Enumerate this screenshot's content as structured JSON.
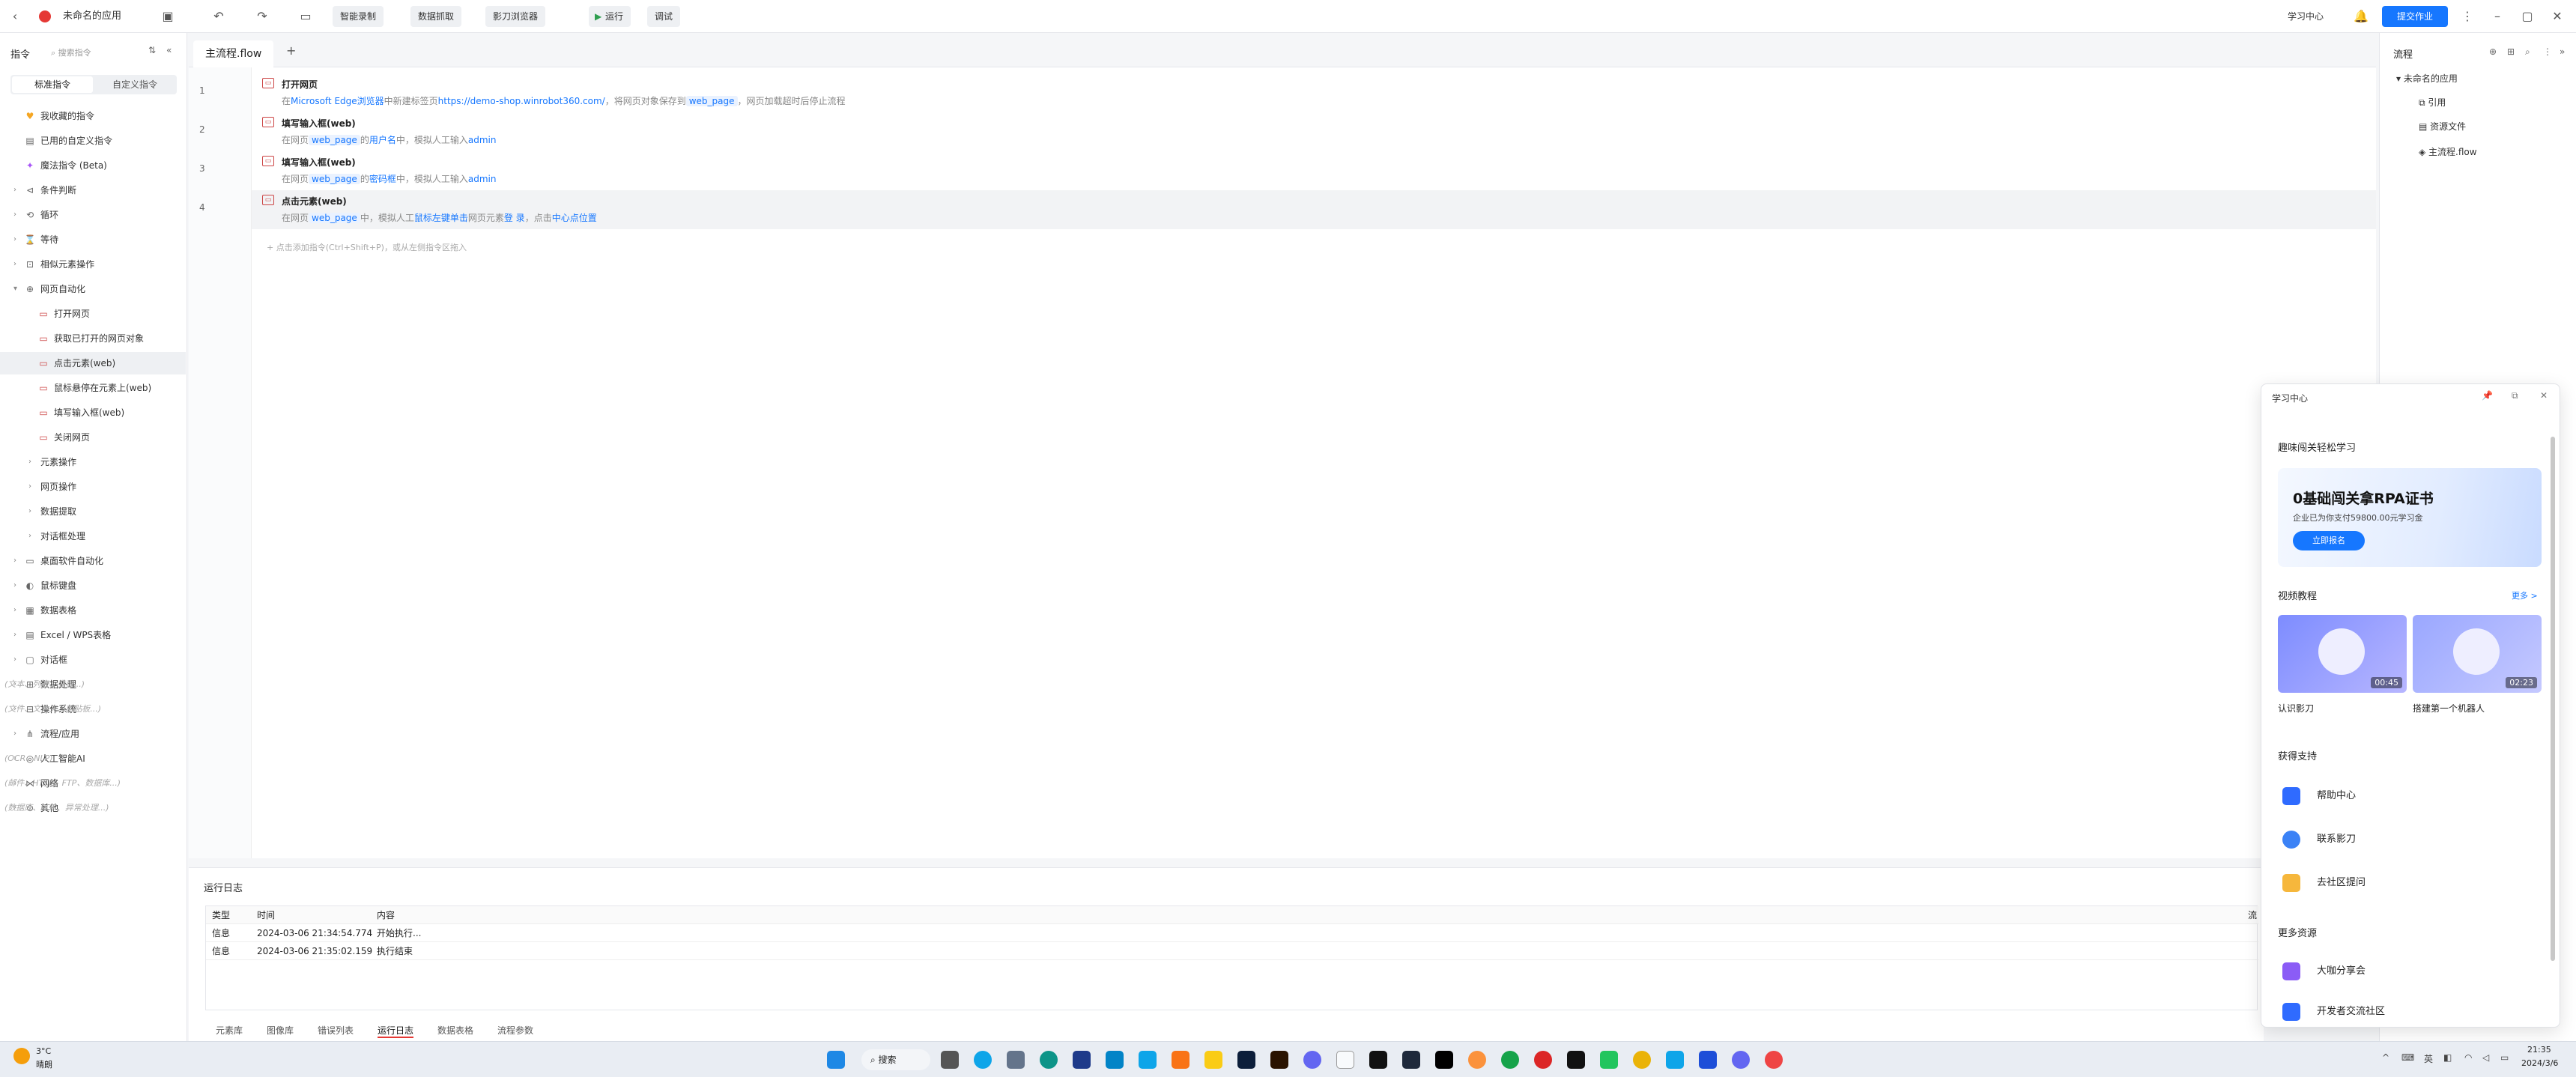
{
  "app": {
    "title": "未命名的应用",
    "toolbar": {
      "smart_record": "智能录制",
      "data_capture": "数据抓取",
      "browser": "影刀浏览器",
      "run": "运行",
      "debug": "调试",
      "learning_center": "学习中心",
      "submit": "提交作业"
    }
  },
  "left_panel": {
    "title": "指令",
    "search_placeholder": "搜索指令",
    "tabs": [
      "标准指令",
      "自定义指令"
    ],
    "items": [
      {
        "label": "我收藏的指令",
        "hint": ""
      },
      {
        "label": "已用的自定义指令",
        "hint": ""
      },
      {
        "label": "魔法指令 (Beta)",
        "hint": ""
      },
      {
        "label": "条件判断",
        "hint": ""
      },
      {
        "label": "循环",
        "hint": ""
      },
      {
        "label": "等待",
        "hint": ""
      },
      {
        "label": "相似元素操作",
        "hint": ""
      },
      {
        "label": "网页自动化",
        "hint": ""
      },
      {
        "label": "打开网页",
        "hint": ""
      },
      {
        "label": "获取已打开的网页对象",
        "hint": ""
      },
      {
        "label": "点击元素(web)",
        "hint": ""
      },
      {
        "label": "鼠标悬停在元素上(web)",
        "hint": ""
      },
      {
        "label": "填写输入框(web)",
        "hint": ""
      },
      {
        "label": "关闭网页",
        "hint": ""
      },
      {
        "label": "元素操作",
        "hint": ""
      },
      {
        "label": "网页操作",
        "hint": ""
      },
      {
        "label": "数据提取",
        "hint": ""
      },
      {
        "label": "对话框处理",
        "hint": ""
      },
      {
        "label": "桌面软件自动化",
        "hint": ""
      },
      {
        "label": "鼠标键盘",
        "hint": ""
      },
      {
        "label": "数据表格",
        "hint": ""
      },
      {
        "label": "Excel / WPS表格",
        "hint": ""
      },
      {
        "label": "对话框",
        "hint": ""
      },
      {
        "label": "数据处理",
        "hint": "(文本、列表、变量...)"
      },
      {
        "label": "操作系统",
        "hint": "(文件、文件夹、剪贴板...)"
      },
      {
        "label": "流程/应用",
        "hint": ""
      },
      {
        "label": "人工智能AI",
        "hint": "(OCR、NLP)"
      },
      {
        "label": "网络",
        "hint": "(邮件、HTTP、FTP、数据库...)"
      },
      {
        "label": "其他",
        "hint": "(数据库、PDF、异常处理...)"
      }
    ]
  },
  "editor": {
    "tab": "主流程.flow",
    "steps": [
      {
        "num": "1",
        "title": "打开网页",
        "d": [
          "在",
          "Microsoft Edge浏览器",
          "中新建标签页",
          "https://demo-shop.winrobot360.com/",
          "，将网页对象保存到",
          "web_page",
          "，网页加载超时后停止流程"
        ]
      },
      {
        "num": "2",
        "title": "填写输入框(web)",
        "d": [
          "在网页",
          "web_page",
          "的",
          "用户名",
          "中，模拟人工输入",
          "admin",
          "",
          ""
        ]
      },
      {
        "num": "3",
        "title": "填写输入框(web)",
        "d": [
          "在网页",
          "web_page",
          "的",
          "密码框",
          "中，模拟人工输入",
          "admin",
          "",
          ""
        ]
      },
      {
        "num": "4",
        "title": "点击元素(web)",
        "d": [
          "在网页",
          "web_page",
          "中，模拟人工",
          "鼠标左键单击",
          "网页元素",
          "登 录",
          "，点击",
          "中心点位置"
        ]
      }
    ],
    "add_hint": "点击添加指令(Ctrl+Shift+P)，或从左侧指令区拖入"
  },
  "log": {
    "title": "运行日志",
    "headers": [
      "类型",
      "时间",
      "内容"
    ],
    "extra_header": "流",
    "rows": [
      [
        "信息",
        "2024-03-06 21:34:54.774",
        "开始执行..."
      ],
      [
        "信息",
        "2024-03-06 21:35:02.159",
        "执行结束"
      ]
    ],
    "tabs": [
      "元素库",
      "图像库",
      "错误列表",
      "运行日志",
      "数据表格",
      "流程参数"
    ]
  },
  "right_panel": {
    "title": "流程",
    "root": "未命名的应用",
    "children": [
      "引用",
      "资源文件",
      "主流程.flow"
    ]
  },
  "learning": {
    "title": "学习中心",
    "subtitle": "趣味闯关轻松学习",
    "banner_title": "0基础闯关拿RPA证书",
    "banner_sub": "企业已为你支付59800.00元学习金",
    "banner_btn": "立即报名",
    "video_section": "视频教程",
    "more": "更多 >",
    "videos": [
      {
        "title": "认识影刀",
        "duration": "00:45"
      },
      {
        "title": "搭建第一个机器人",
        "duration": "02:23"
      }
    ],
    "support_title": "获得支持",
    "support": [
      "帮助中心",
      "联系影刀",
      "去社区提问"
    ],
    "more_res_title": "更多资源",
    "resources": [
      "大咖分享会",
      "开发者交流社区"
    ]
  },
  "taskbar": {
    "weather_temp": "3°C",
    "weather_text": "晴朗",
    "search": "搜索",
    "ime": "英",
    "time": "21:35",
    "date": "2024/3/6"
  }
}
